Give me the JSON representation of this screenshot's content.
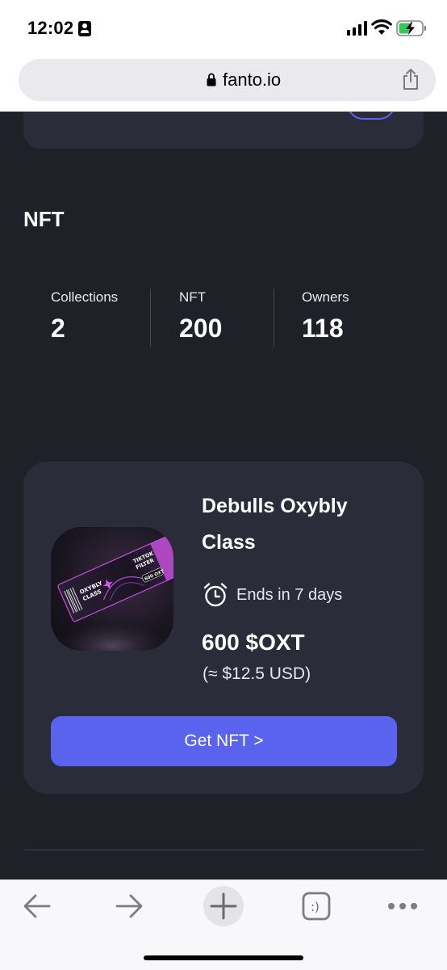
{
  "status_bar": {
    "time": "12:02",
    "icons": [
      "contact-card-icon",
      "signal-icon",
      "wifi-icon",
      "battery-charging-icon"
    ]
  },
  "browser": {
    "url": "fanto.io",
    "icons": [
      "lock-icon",
      "share-icon"
    ],
    "toolbar": [
      "back-icon",
      "forward-icon",
      "new-tab-icon",
      "tabs-icon",
      "more-icon"
    ]
  },
  "section": {
    "title": "NFT"
  },
  "stats": [
    {
      "label": "Collections",
      "value": "2"
    },
    {
      "label": "NFT",
      "value": "200"
    },
    {
      "label": "Owners",
      "value": "118"
    }
  ],
  "nft_card": {
    "title": "Debulls Oxybly Class",
    "ends": "Ends in 7 days",
    "price": "600 $OXT",
    "usd": "(≈ $12.5 USD)",
    "button": "Get NFT >",
    "ticket": {
      "name_lines": [
        "OXYBLY",
        "CLASS"
      ],
      "title_lines": [
        "TIKTOK",
        "FILTER"
      ],
      "price": "600 OXT"
    }
  },
  "colors": {
    "background": "#1f2129",
    "card": "#2a2c3a",
    "accent": "#5a63ee"
  }
}
